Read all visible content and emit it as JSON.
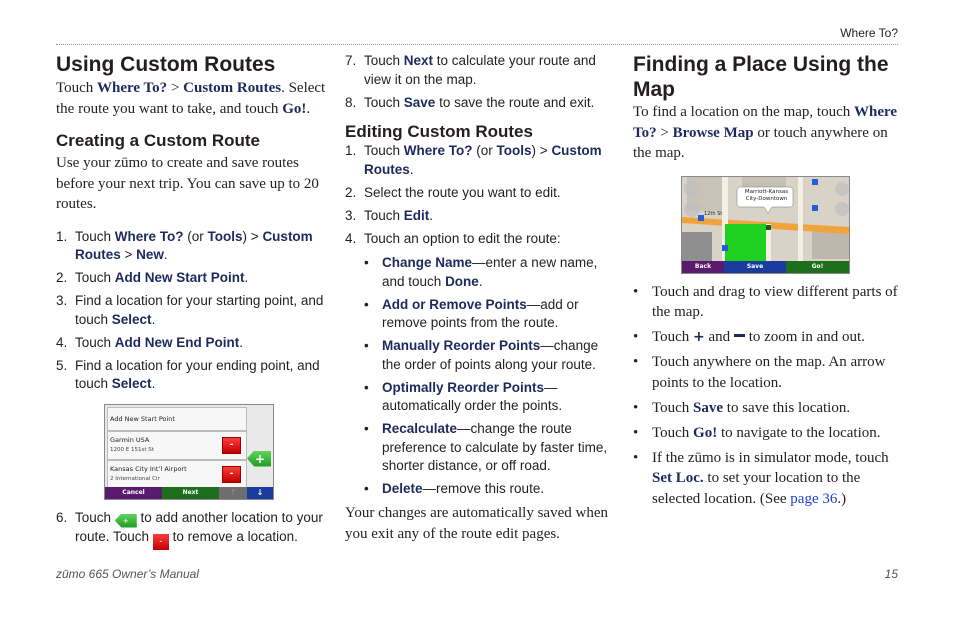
{
  "header": {
    "running_head": "Where To?"
  },
  "footer": {
    "manual_title": "zūmo 665 Owner’s Manual",
    "page_number": "15"
  },
  "col1": {
    "title": "Using Custom Routes",
    "intro": {
      "t1": "Touch ",
      "b1": "Where To?",
      "t2": " > ",
      "b2": "Custom Routes",
      "t3": ". Select the route you want to take, and touch ",
      "b3": "Go!",
      "t4": "."
    },
    "subtitle": "Creating a Custom Route",
    "sub_intro": "Use your zūmo to create and save routes before your next trip. You can save up to 20 routes.",
    "steps": [
      {
        "n": "1.",
        "t1": "Touch ",
        "b1": "Where To?",
        "t2": " (or ",
        "b2": "Tools",
        "t3": ") > ",
        "b3": "Custom Routes",
        "t4": " > ",
        "b4": "New",
        "t5": "."
      },
      {
        "n": "2.",
        "t1": "Touch ",
        "b1": "Add New Start Point",
        "t2": "."
      },
      {
        "n": "3.",
        "t1": "Find a location for your starting point, and touch ",
        "b1": "Select",
        "t2": "."
      },
      {
        "n": "4.",
        "t1": "Touch ",
        "b1": "Add New End Point",
        "t2": "."
      },
      {
        "n": "5.",
        "t1": "Find a location for your ending point, and touch ",
        "b1": "Select",
        "t2": "."
      }
    ],
    "screen": {
      "header_row": "Add New Start Point",
      "items": [
        {
          "name": "Garmin USA",
          "address": "1200 E 151st St"
        },
        {
          "name": "Kansas City Int’l Airport",
          "address": "2 International Cir"
        }
      ],
      "remove_glyph": "-",
      "add_glyph": "+",
      "buttons": {
        "cancel": "Cancel",
        "next": "Next",
        "up": "↑",
        "down": "↓"
      },
      "colors": {
        "cancel": "#5a1a6e",
        "next": "#1d6e1d",
        "up": "#6e6e6e",
        "down": "#1a3c9e"
      }
    },
    "step6": {
      "n": "6.",
      "t1": "Touch ",
      "t2": " to add another location to your route. Touch ",
      "t3": " to remove a location."
    }
  },
  "col2": {
    "steps": [
      {
        "n": "7.",
        "t1": "Touch ",
        "b1": "Next",
        "t2": " to calculate your route and view it on the map."
      },
      {
        "n": "8.",
        "t1": "Touch ",
        "b1": "Save",
        "t2": " to save the route and exit."
      }
    ],
    "subtitle": "Editing Custom Routes",
    "edit_steps": [
      {
        "n": "1.",
        "t1": "Touch ",
        "b1": "Where To?",
        "t2": " (or ",
        "b2": "Tools",
        "t3": ") > ",
        "b3": "Custom Routes",
        "t4": "."
      },
      {
        "n": "2.",
        "t1": "Select the route you want to edit."
      },
      {
        "n": "3.",
        "t1": "Touch ",
        "b1": "Edit",
        "t2": "."
      },
      {
        "n": "4.",
        "t1": "Touch an option to edit the route:"
      }
    ],
    "options": [
      {
        "b1": "Change Name",
        "t1": "—enter a new name, and touch ",
        "b2": "Done",
        "t2": "."
      },
      {
        "b1": "Add or Remove Points",
        "t1": "—add or remove points from the route."
      },
      {
        "b1": "Manually Reorder Points",
        "t1": "—change the order of points along your route."
      },
      {
        "b1": "Optimally Reorder Points",
        "t1": "— automatically order the points."
      },
      {
        "b1": "Recalculate",
        "t1": "—change the route preference to calculate by faster time, shorter distance, or off road."
      },
      {
        "b1": "Delete",
        "t1": "—remove this route."
      }
    ],
    "closing": "Your changes are automatically saved when you exit any of the route edit pages."
  },
  "col3": {
    "title": "Finding a Place Using the Map",
    "intro": {
      "t1": "To find a location on the map, touch ",
      "b1": "Where To?",
      "t2": " > ",
      "b2": "Browse Map",
      "t3": " or touch anywhere on the map."
    },
    "map": {
      "callout": "Marriott-Kansas City-Downtown",
      "street": "12th St",
      "buttons": {
        "back": "Back",
        "save": "Save",
        "go": "Go!"
      },
      "colors": {
        "back": "#5a1a6e",
        "save": "#1a3c9e",
        "go": "#1d6e1d",
        "park": "#1fd01f"
      }
    },
    "bullets": [
      {
        "t1": "Touch and drag to view different parts of the map."
      },
      {
        "t1": "Touch ",
        "t2": " and ",
        "t3": " to zoom in and out."
      },
      {
        "t1": "Touch anywhere on the map. An arrow points to the location."
      },
      {
        "t1": "Touch ",
        "b1": "Save",
        "t2": " to save this location."
      },
      {
        "t1": "Touch ",
        "b1": "Go!",
        "t2": " to navigate to the location."
      },
      {
        "t1": "If the zūmo is in simulator mode, touch ",
        "b1": "Set Loc.",
        "t2": " to set your location to the selected location. (See ",
        "link": "page 36",
        "t3": ".)"
      }
    ],
    "bullet_glyph": "•"
  }
}
